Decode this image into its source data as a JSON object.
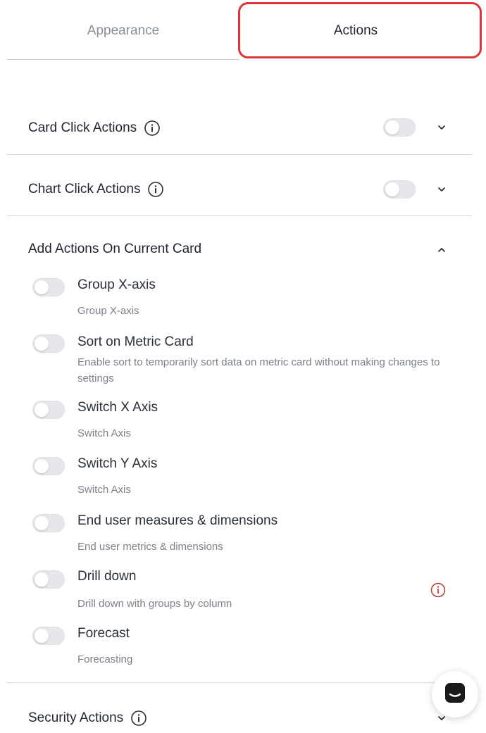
{
  "tabs": {
    "appearance": "Appearance",
    "actions": "Actions",
    "active": "actions",
    "highlight_color": "#d9373a"
  },
  "sections": {
    "card_click": {
      "title": "Card Click Actions",
      "enabled": false,
      "expanded": false
    },
    "chart_click": {
      "title": "Chart Click Actions",
      "enabled": false,
      "expanded": false
    },
    "current_card": {
      "title": "Add Actions On Current Card",
      "expanded": true
    },
    "security": {
      "title": "Security Actions",
      "expanded": false
    }
  },
  "options": [
    {
      "label": "Group X-axis",
      "description": "Group X-axis",
      "enabled": false
    },
    {
      "label": "Sort on Metric Card",
      "description": "Enable sort to temporarily sort data on metric card without making changes to settings",
      "enabled": false
    },
    {
      "label": "Switch X Axis",
      "description": "Switch Axis",
      "enabled": false
    },
    {
      "label": "Switch Y Axis",
      "description": "Switch Axis",
      "enabled": false
    },
    {
      "label": "End user measures & dimensions",
      "description": "End user metrics & dimensions",
      "enabled": false
    },
    {
      "label": "Drill down",
      "description": "Drill down with groups by column",
      "enabled": false,
      "warning_icon": "info-red-icon"
    },
    {
      "label": "Forecast",
      "description": "Forecasting",
      "enabled": false
    }
  ],
  "icons": {
    "info": "info-icon",
    "chevron_down": "chevron-down-icon",
    "chevron_up": "chevron-up-icon",
    "chat": "chat-icon"
  },
  "colors": {
    "warning": "#c0392b",
    "toggle_off": "#e6e7ea"
  }
}
